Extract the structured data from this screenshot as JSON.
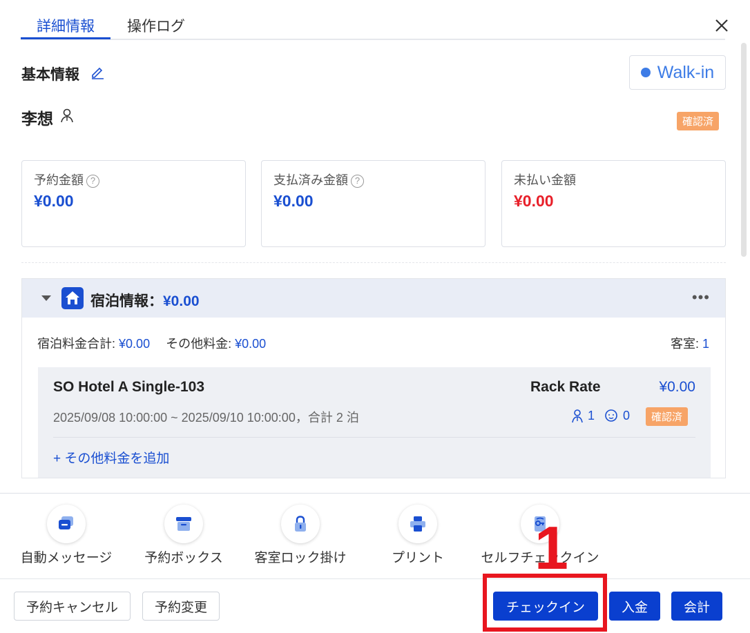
{
  "tabs": [
    {
      "label": "詳細情報",
      "active": true
    },
    {
      "label": "操作ログ",
      "active": false
    }
  ],
  "basic_info": {
    "title": "基本情報",
    "source_badge": "Walk-in",
    "guest_name": "李想",
    "status": "確認済"
  },
  "amounts": [
    {
      "label": "予約金額",
      "value": "¥0.00",
      "has_help": true,
      "color": "#1a4fd1"
    },
    {
      "label": "支払済み金額",
      "value": "¥0.00",
      "has_help": true,
      "color": "#1a4fd1"
    },
    {
      "label": "未払い金額",
      "value": "¥0.00",
      "has_help": false,
      "color": "#e8202a"
    }
  ],
  "stay": {
    "title": "宿泊情報",
    "total": "¥0.00",
    "room_fee_label": "宿泊料金合計:",
    "room_fee": "¥0.00",
    "other_fee_label": "その他料金:",
    "other_fee": "¥0.00",
    "rooms_label": "客室:",
    "rooms_count": "1",
    "room": {
      "name": "SO Hotel A Single-103",
      "rate_name": "Rack Rate",
      "rate_price": "¥0.00",
      "dates": "2025/09/08 10:00:00 ~ 2025/09/10 10:00:00，合計 2 泊",
      "adults": "1",
      "children": "0",
      "status": "確認済",
      "add_fee_label": "+ その他料金を追加"
    }
  },
  "actions": [
    {
      "label": "自動メッセージ",
      "icon": "message-icon"
    },
    {
      "label": "予約ボックス",
      "icon": "box-icon"
    },
    {
      "label": "客室ロック掛け",
      "icon": "lock-icon"
    },
    {
      "label": "プリント",
      "icon": "printer-icon"
    },
    {
      "label": "セルフチェックイン",
      "icon": "self-checkin-icon"
    }
  ],
  "footer": {
    "cancel": "予約キャンセル",
    "modify": "予約変更",
    "checkin": "チェックイン",
    "deposit": "入金",
    "checkout": "会計"
  },
  "annotation": {
    "label": "1",
    "color": "#e8161f"
  },
  "colors": {
    "accent": "#1a4fd1",
    "danger": "#e8202a",
    "confirmed": "#f7a467",
    "walkin": "#3d7ce6"
  }
}
